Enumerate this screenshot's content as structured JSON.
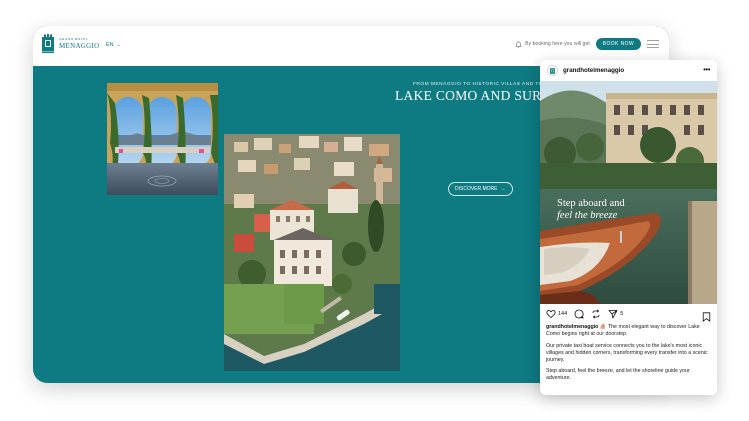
{
  "site": {
    "logo_small": "GRAND HOTEL",
    "logo_big": "MENAGGIO",
    "language": "EN",
    "booking_note": "By booking here you will get",
    "book_now": "BOOK NOW",
    "hero_subtitle": "FROM MENAGGIO TO HISTORIC VILLAS AND THE FAM",
    "hero_title": "LAKE COMO AND SURRO",
    "discover_more": "DISCOVER MORE",
    "accent_color": "#0e7a82"
  },
  "instagram": {
    "username": "grandhotelmenaggio",
    "overlay_line1": "Step aboard and",
    "overlay_line2": "feel the breeze",
    "likes": "144",
    "shares": "5",
    "caption_user": "grandhotelmenaggio",
    "caption_text": "⛵ The most elegant way to discover Lake Como begins right at our doorstep.",
    "caption_p2": "Our private taxi boat service connects you to the lake's most iconic villages and hidden corners, transforming every transfer into a scenic journey.",
    "caption_p3": "Step aboard, feel the breeze, and let the shoreline guide your adventure."
  }
}
